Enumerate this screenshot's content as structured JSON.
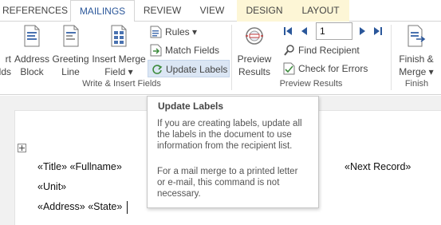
{
  "tabs": [
    {
      "label": "REFERENCES"
    },
    {
      "label": "MAILINGS"
    },
    {
      "label": "REVIEW"
    },
    {
      "label": "VIEW"
    },
    {
      "label": "DESIGN"
    },
    {
      "label": "LAYOUT"
    }
  ],
  "ribbon": {
    "write_insert": {
      "cut_left": {
        "line1": "rt",
        "line2": "lds"
      },
      "address_block": {
        "line1": "Address",
        "line2": "Block"
      },
      "greeting_line": {
        "line1": "Greeting",
        "line2": "Line"
      },
      "insert_merge_field": {
        "line1": "Insert Merge",
        "line2": "Field",
        "arrow": "▾"
      },
      "rules": {
        "label": "Rules",
        "arrow": "▾"
      },
      "match_fields": {
        "label": "Match Fields"
      },
      "update_labels": {
        "label": "Update Labels"
      },
      "group_label": "Write & Insert Fields"
    },
    "preview": {
      "preview_results": {
        "line1": "Preview",
        "line2": "Results"
      },
      "record_number": "1",
      "find_recipient": {
        "label": "Find Recipient"
      },
      "check_errors": {
        "label": "Check for Errors"
      },
      "group_label": "Preview Results"
    },
    "finish": {
      "finish_merge": {
        "line1": "Finish &",
        "line2": "Merge",
        "arrow": "▾"
      },
      "group_label": "Finish"
    }
  },
  "tooltip": {
    "title": "Update Labels",
    "lines": [
      "If you are creating labels, update all",
      "the labels in the document to use",
      "information from the recipient list.",
      "",
      "For a mail merge to a printed letter",
      "or e-mail, this command is not",
      "necessary."
    ]
  },
  "document": {
    "line1": "«Title» «Fullname»",
    "line2": "«Unit»",
    "line3": "«Address» «State»",
    "next_record": "«Next Record»"
  },
  "colors": {
    "accent": "#2b579a",
    "context_tab": "#fdf6d6",
    "highlight": "#dbe6f4"
  }
}
